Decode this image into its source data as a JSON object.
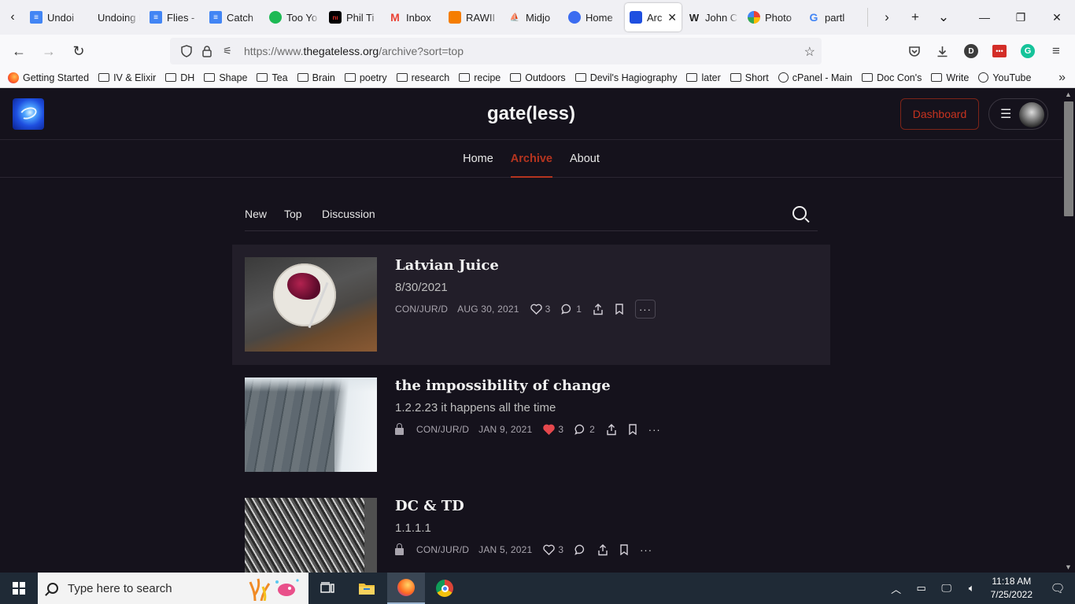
{
  "browser": {
    "tabs": [
      {
        "label": "Undoi",
        "icon": "docs-icon",
        "color": "#4285f4"
      },
      {
        "label": "Undoing H",
        "icon": "",
        "color": ""
      },
      {
        "label": "Flies -",
        "icon": "docs-icon",
        "color": "#4285f4"
      },
      {
        "label": "Catch",
        "icon": "docs-icon",
        "color": "#4285f4"
      },
      {
        "label": "Too Yo",
        "icon": "spotify-icon",
        "color": "#1db954"
      },
      {
        "label": "Phil Ti",
        "icon": "nin-icon",
        "color": "#000000"
      },
      {
        "label": "Inbox",
        "icon": "gmail-icon",
        "color": "#ea4335"
      },
      {
        "label": "RAWII",
        "icon": "blogger-icon",
        "color": "#f57d00"
      },
      {
        "label": "Midjo",
        "icon": "midjourney-icon",
        "color": "#555555"
      },
      {
        "label": "Home",
        "icon": "home-c-icon",
        "color": "#3b6cf0"
      },
      {
        "label": "Arc",
        "icon": "gateless-icon",
        "color": "#1e4fe0",
        "active": true
      },
      {
        "label": "John C",
        "icon": "wikipedia-icon",
        "color": "#333333"
      },
      {
        "label": "Photo",
        "icon": "photos-icon",
        "color": "#fbbc04"
      },
      {
        "label": "partl",
        "icon": "google-icon",
        "color": "#4285f4"
      }
    ],
    "active_tab_close": "✕",
    "url_prefix": "https://www.",
    "url_domain": "thegateless.org",
    "url_path": "/archive?sort=top",
    "account_initial": "D"
  },
  "bookmarks": [
    {
      "label": "Getting Started",
      "type": "firefox"
    },
    {
      "label": "IV & Elixir",
      "type": "folder"
    },
    {
      "label": "DH",
      "type": "folder"
    },
    {
      "label": "Shape",
      "type": "folder"
    },
    {
      "label": "Tea",
      "type": "folder"
    },
    {
      "label": "Brain",
      "type": "folder"
    },
    {
      "label": "poetry",
      "type": "folder"
    },
    {
      "label": "research",
      "type": "folder"
    },
    {
      "label": "recipe",
      "type": "folder"
    },
    {
      "label": "Outdoors",
      "type": "folder"
    },
    {
      "label": "Devil's Hagiography",
      "type": "folder"
    },
    {
      "label": "later",
      "type": "folder"
    },
    {
      "label": "Short",
      "type": "folder"
    },
    {
      "label": "cPanel - Main",
      "type": "globe"
    },
    {
      "label": "Doc Con's",
      "type": "folder"
    },
    {
      "label": "Write",
      "type": "folder"
    },
    {
      "label": "YouTube",
      "type": "globe"
    }
  ],
  "site": {
    "title": "gate(less)",
    "dashboard_label": "Dashboard",
    "nav": [
      {
        "label": "Home",
        "active": false
      },
      {
        "label": "Archive",
        "active": true
      },
      {
        "label": "About",
        "active": false
      }
    ],
    "filters": [
      {
        "label": "New",
        "active": false
      },
      {
        "label": "Top",
        "active": true
      },
      {
        "label": "Discussion",
        "active": false
      }
    ],
    "accent_color": "#b5341f"
  },
  "posts": [
    {
      "title": "Latvian Juice",
      "subtitle": "8/30/2021",
      "author": "CON/JUR/D",
      "date": "AUG 30, 2021",
      "likes": "3",
      "comments": "1",
      "locked": false,
      "liked": false,
      "highlighted": true
    },
    {
      "title": "the impossibility of change",
      "subtitle": "1.2.2.23 it happens all the time",
      "author": "CON/JUR/D",
      "date": "JAN 9, 2021",
      "likes": "3",
      "comments": "2",
      "locked": true,
      "liked": true,
      "highlighted": false
    },
    {
      "title": "DC & TD",
      "subtitle": "1.1.1.1",
      "author": "CON/JUR/D",
      "date": "JAN 5, 2021",
      "likes": "3",
      "comments": "",
      "locked": true,
      "liked": false,
      "highlighted": false
    }
  ],
  "taskbar": {
    "search_placeholder": "Type here to search",
    "time": "11:18 AM",
    "date": "7/25/2022"
  }
}
